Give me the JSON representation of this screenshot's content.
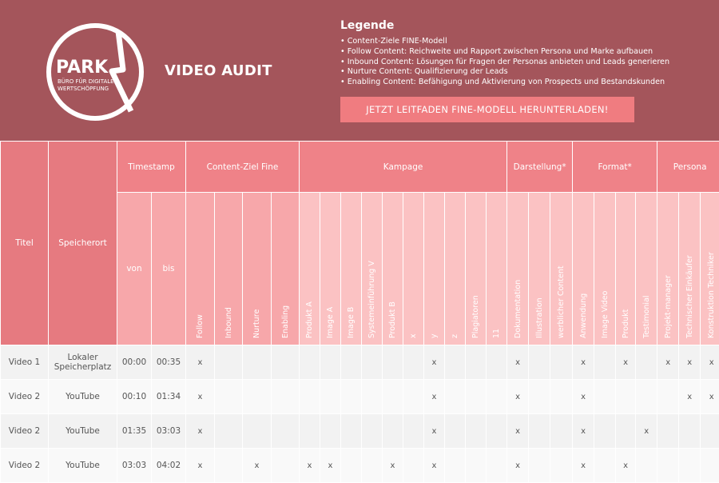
{
  "header": {
    "logo": {
      "word": "PARK",
      "line1": "BÜRO FÜR DIGITALE",
      "line2": "WERTSCHÖPFUNG",
      "number": "7"
    },
    "title": "VIDEO AUDIT",
    "legend": {
      "title": "Legende",
      "items": [
        "Content-Ziele FINE-Modell",
        "Follow Content: Reichweite und Rapport zwischen Persona und Marke aufbauen",
        "Inbound Content: Lösungen für Fragen der Personas anbieten und Leads generieren",
        "Nurture Content: Qualifizierung der Leads",
        "Enabling Content: Befähigung und Aktivierung von Prospects und Bestandskunden"
      ]
    },
    "cta_label": "JETZT LEITFADEN FINE-MODELL HERUNTERLADEN!"
  },
  "colors": {
    "header_bg": "#a4555b",
    "cta_bg": "#f07c80",
    "table_header": "#ef8288",
    "table_header_light": "#fbc2c3"
  },
  "table": {
    "col_titel": "Titel",
    "col_speicherort": "Speicherort",
    "groups": {
      "timestamp": "Timestamp",
      "content_ziel": "Content-Ziel Fine",
      "kampage": "Kampage",
      "darstellung": "Darstellung*",
      "format": "Format*",
      "persona": "Persona"
    },
    "sub": [
      "von",
      "bis",
      "Follow",
      "Inbound",
      "Nurture",
      "Enabling",
      "Produkt A",
      "Image A",
      "Image B",
      "Systemeinführung V",
      "Produkt B",
      "x",
      "y",
      "z",
      "Plagiatoren",
      "11",
      "Dokumentation",
      "Illustration",
      "werblicher Content",
      "Anwendung",
      "Image Video",
      "Produkt",
      "Testimonial",
      "Projekt-manager",
      "Technischer Einkäufer",
      "Konstruktion Techniker"
    ],
    "rows": [
      {
        "titel": "Video 1",
        "ort": "Lokaler Speicherplatz",
        "von": "00:00",
        "bis": "00:35",
        "marks": [
          "x",
          "",
          "",
          "",
          "",
          "",
          "",
          "",
          "",
          "",
          "x",
          "",
          "",
          "",
          "x",
          "",
          "",
          "x",
          "",
          "x",
          "",
          "x",
          "x",
          "x"
        ]
      },
      {
        "titel": "Video 2",
        "ort": "YouTube",
        "von": "00:10",
        "bis": "01:34",
        "marks": [
          "x",
          "",
          "",
          "",
          "",
          "",
          "",
          "",
          "",
          "",
          "x",
          "",
          "",
          "",
          "x",
          "",
          "",
          "x",
          "",
          "",
          "",
          "",
          "x",
          "x"
        ]
      },
      {
        "titel": "Video 2",
        "ort": "YouTube",
        "von": "01:35",
        "bis": "03:03",
        "marks": [
          "x",
          "",
          "",
          "",
          "",
          "",
          "",
          "",
          "",
          "",
          "x",
          "",
          "",
          "",
          "x",
          "",
          "",
          "x",
          "",
          "",
          "x",
          "",
          "",
          ""
        ]
      },
      {
        "titel": "Video 2",
        "ort": "YouTube",
        "von": "03:03",
        "bis": "04:02",
        "marks": [
          "x",
          "",
          "x",
          "",
          "x",
          "x",
          "",
          "",
          "x",
          "",
          "x",
          "",
          "",
          "",
          "x",
          "",
          "",
          "x",
          "",
          "x",
          "",
          "",
          "",
          ""
        ]
      }
    ]
  }
}
